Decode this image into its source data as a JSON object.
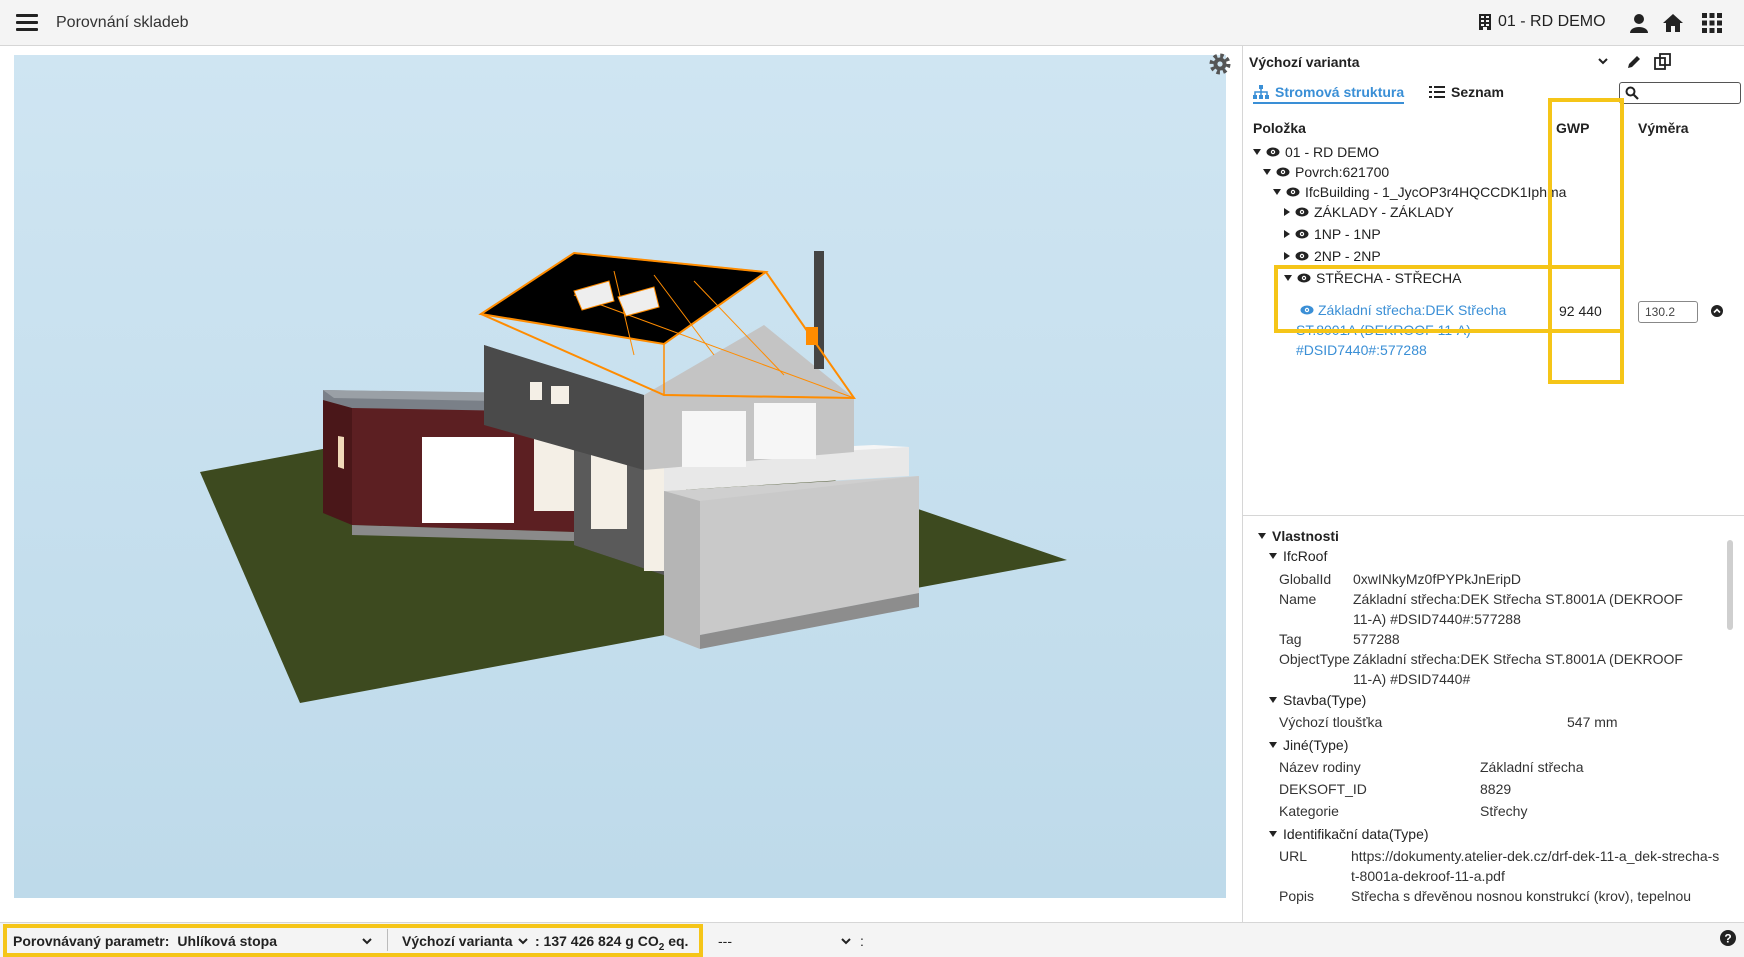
{
  "header": {
    "title": "Porovnání skladeb",
    "project": "01 - RD DEMO"
  },
  "panel": {
    "variant": "Výchozí varianta",
    "tabs": {
      "tree": "Stromová struktura",
      "list": "Seznam"
    },
    "search_placeholder": "",
    "columns": {
      "item": "Položka",
      "gwp": "GWP",
      "area": "Výměra"
    },
    "tree": [
      {
        "label": "01 - RD DEMO",
        "expanded": true
      },
      {
        "label": "Povrch:621700",
        "expanded": true
      },
      {
        "label": "IfcBuilding - 1_JycOP3r4HQCCDK1Iphma",
        "expanded": true
      },
      {
        "label": "ZÁKLADY - ZÁKLADY",
        "expanded": false
      },
      {
        "label": "1NP - 1NP",
        "expanded": false
      },
      {
        "label": "2NP - 2NP",
        "expanded": false
      },
      {
        "label": "STŘECHA - STŘECHA",
        "expanded": true
      }
    ],
    "selected": {
      "label": "Základní střecha:DEK Střecha ST.8001A (DEKROOF 11-A) #DSID7440#:577288",
      "gwp": "92 440",
      "area": "130.2"
    }
  },
  "properties": {
    "title": "Vlastnosti",
    "sections": [
      {
        "name": "IfcRoof",
        "rows": [
          {
            "k": "GlobalId",
            "v": "0xwINkyMz0fPYPkJnEripD"
          },
          {
            "k": "Name",
            "v": "Základní střecha:DEK Střecha ST.8001A (DEKROOF 11-A) #DSID7440#:577288"
          },
          {
            "k": "Tag",
            "v": "577288"
          },
          {
            "k": "ObjectType",
            "v": "Základní střecha:DEK Střecha ST.8001A (DEKROOF 11-A) #DSID7440#"
          }
        ]
      },
      {
        "name": "Stavba(Type)",
        "rows": [
          {
            "k": "Výchozí tloušťka",
            "v": "547 mm"
          }
        ]
      },
      {
        "name": "Jiné(Type)",
        "rows": [
          {
            "k": "Název rodiny",
            "v": "Základní střecha"
          },
          {
            "k": "DEKSOFT_ID",
            "v": "8829"
          },
          {
            "k": "Kategorie",
            "v": "Střechy"
          }
        ]
      },
      {
        "name": "Identifikační data(Type)",
        "rows": [
          {
            "k": "URL",
            "v": "https://dokumenty.atelier-dek.cz/drf-dek-11-a_dek-strecha-st-8001a-dekroof-11-a.pdf"
          },
          {
            "k": "Popis",
            "v": "Střecha s dřevěnou nosnou konstrukcí (krov), tepelnou"
          }
        ]
      }
    ]
  },
  "bottom": {
    "param_label": "Porovnávaný parametr:",
    "param_value": "Uhlíková stopa",
    "variant": "Výchozí varianta",
    "total_prefix": ": 137 426 824 g CO",
    "total_sub": "2",
    "total_suffix": " eq.",
    "second_variant": "---",
    "second_colon": ":"
  },
  "colors": {
    "accent": "#3a8fd6",
    "highlight": "#f5c518",
    "selection": "#ff8c00"
  }
}
